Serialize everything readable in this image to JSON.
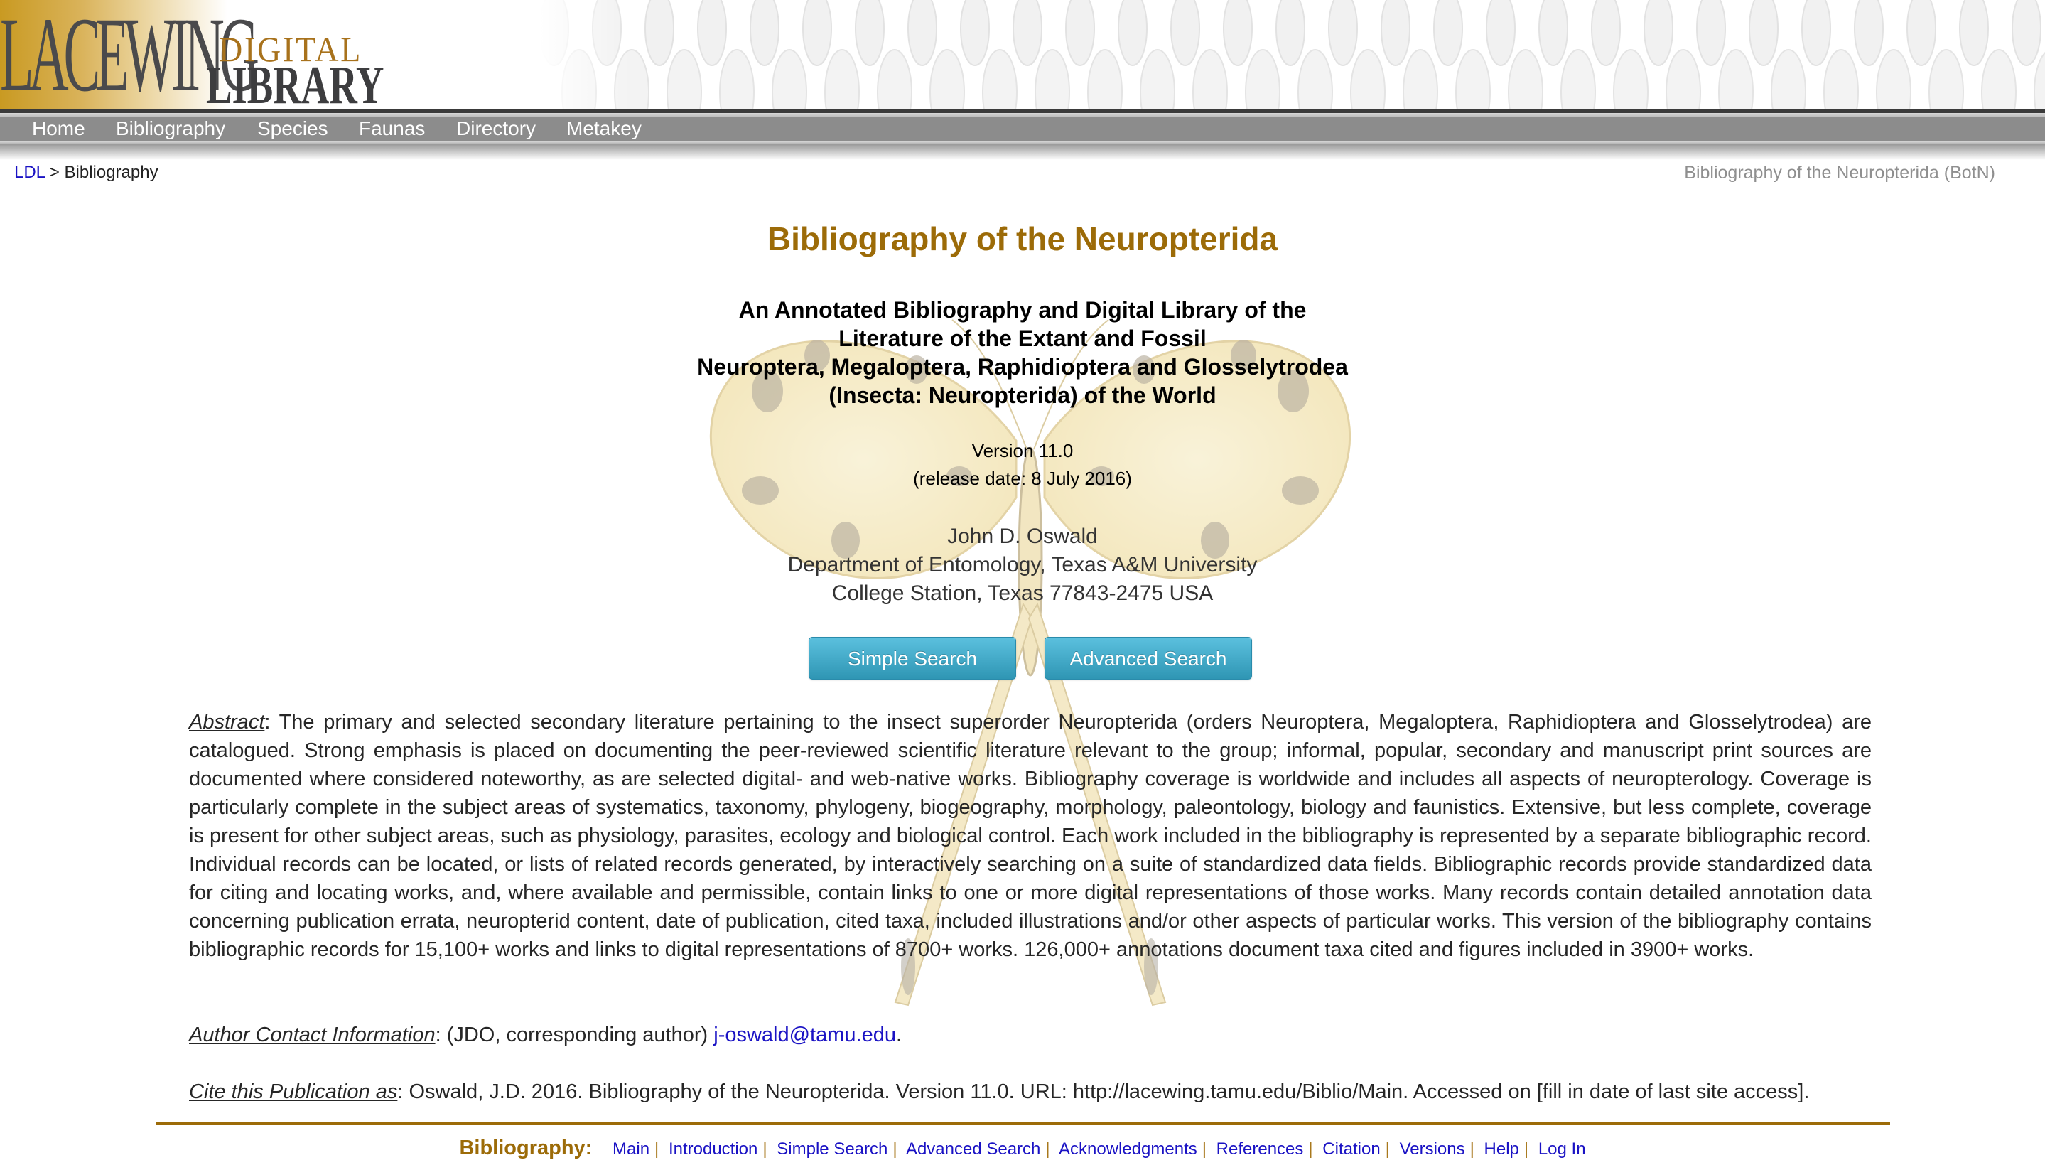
{
  "logo": {
    "word1": "LACEWING",
    "word2": "DIGITAL",
    "word3": "LIBRARY"
  },
  "nav": {
    "items": [
      {
        "label": "Home"
      },
      {
        "label": "Bibliography"
      },
      {
        "label": "Species"
      },
      {
        "label": "Faunas"
      },
      {
        "label": "Directory"
      },
      {
        "label": "Metakey"
      }
    ]
  },
  "breadcrumb": {
    "root": "LDL",
    "separator": " > ",
    "current": "Bibliography"
  },
  "site_tag": "Bibliography of the Neuropterida (BotN)",
  "main": {
    "title": "Bibliography of the Neuropterida",
    "subtitle_lines": [
      "An Annotated Bibliography and Digital Library of the",
      "Literature of the Extant and Fossil",
      "Neuroptera, Megaloptera, Raphidioptera and Glosselytrodea",
      "(Insecta: Neuropterida) of the World"
    ],
    "version": "Version 11.0",
    "release_date": "(release date: 8 July 2016)",
    "author_lines": [
      "John D. Oswald",
      "Department of Entomology, Texas A&M University",
      "College Station, Texas 77843-2475 USA"
    ],
    "buttons": {
      "simple_search": "Simple Search",
      "advanced_search": "Advanced Search"
    },
    "abstract": {
      "label": "Abstract",
      "text": ": The primary and selected secondary literature pertaining to the insect superorder Neuropterida (orders Neuroptera, Megaloptera, Raphidioptera and Glosselytrodea) are catalogued. Strong emphasis is placed on documenting the peer-reviewed scientific literature relevant to the group; informal, popular, secondary and manuscript print sources are documented where considered noteworthy, as are selected digital- and web-native works. Bibliography coverage is worldwide and includes all aspects of neuropterology. Coverage is particularly complete in the subject areas of systematics, taxonomy, phylogeny, biogeography, morphology, paleontology, biology and faunistics. Extensive, but less complete, coverage is present for other subject areas, such as physiology, parasites, ecology and biological control. Each work included in the bibliography is represented by a separate bibliographic record. Individual records can be located, or lists of related records generated, by interactively searching on a suite of standardized data fields. Bibliographic records provide standardized data for citing and locating works, and, where available and permissible, contain links to one or more digital representations of those works. Many records contain detailed annotation data concerning publication errata, neuropterid content, date of publication, cited taxa, included illustrations and/or other aspects of particular works. This version of the bibliography contains bibliographic records for 15,100+ works and links to digital representations of 8700+ works. 126,000+ annotations document taxa cited and figures included in 3900+ works."
    },
    "contact": {
      "label": "Author Contact Information",
      "text": ": (JDO, corresponding author) ",
      "email": "j-oswald@tamu.edu",
      "trail": "."
    },
    "cite": {
      "label": "Cite this Publication as",
      "text": ": Oswald, J.D. 2016. Bibliography of the Neuropterida. Version 11.0. URL: http://lacewing.tamu.edu/Biblio/Main. Accessed on [fill in date of last site access]."
    }
  },
  "footer": {
    "label": "Bibliography:",
    "separator": "|",
    "links": [
      {
        "label": "Main"
      },
      {
        "label": "Introduction"
      },
      {
        "label": "Simple Search"
      },
      {
        "label": "Advanced Search"
      },
      {
        "label": "Acknowledgments"
      },
      {
        "label": "References"
      },
      {
        "label": "Citation"
      },
      {
        "label": "Versions"
      },
      {
        "label": "Help"
      },
      {
        "label": "Log In"
      }
    ]
  },
  "colors": {
    "brand_brown": "#9c6b08",
    "link_blue": "#1a12c4",
    "nav_gray": "#8c8c8c",
    "button_blue": "#2f96b4"
  }
}
